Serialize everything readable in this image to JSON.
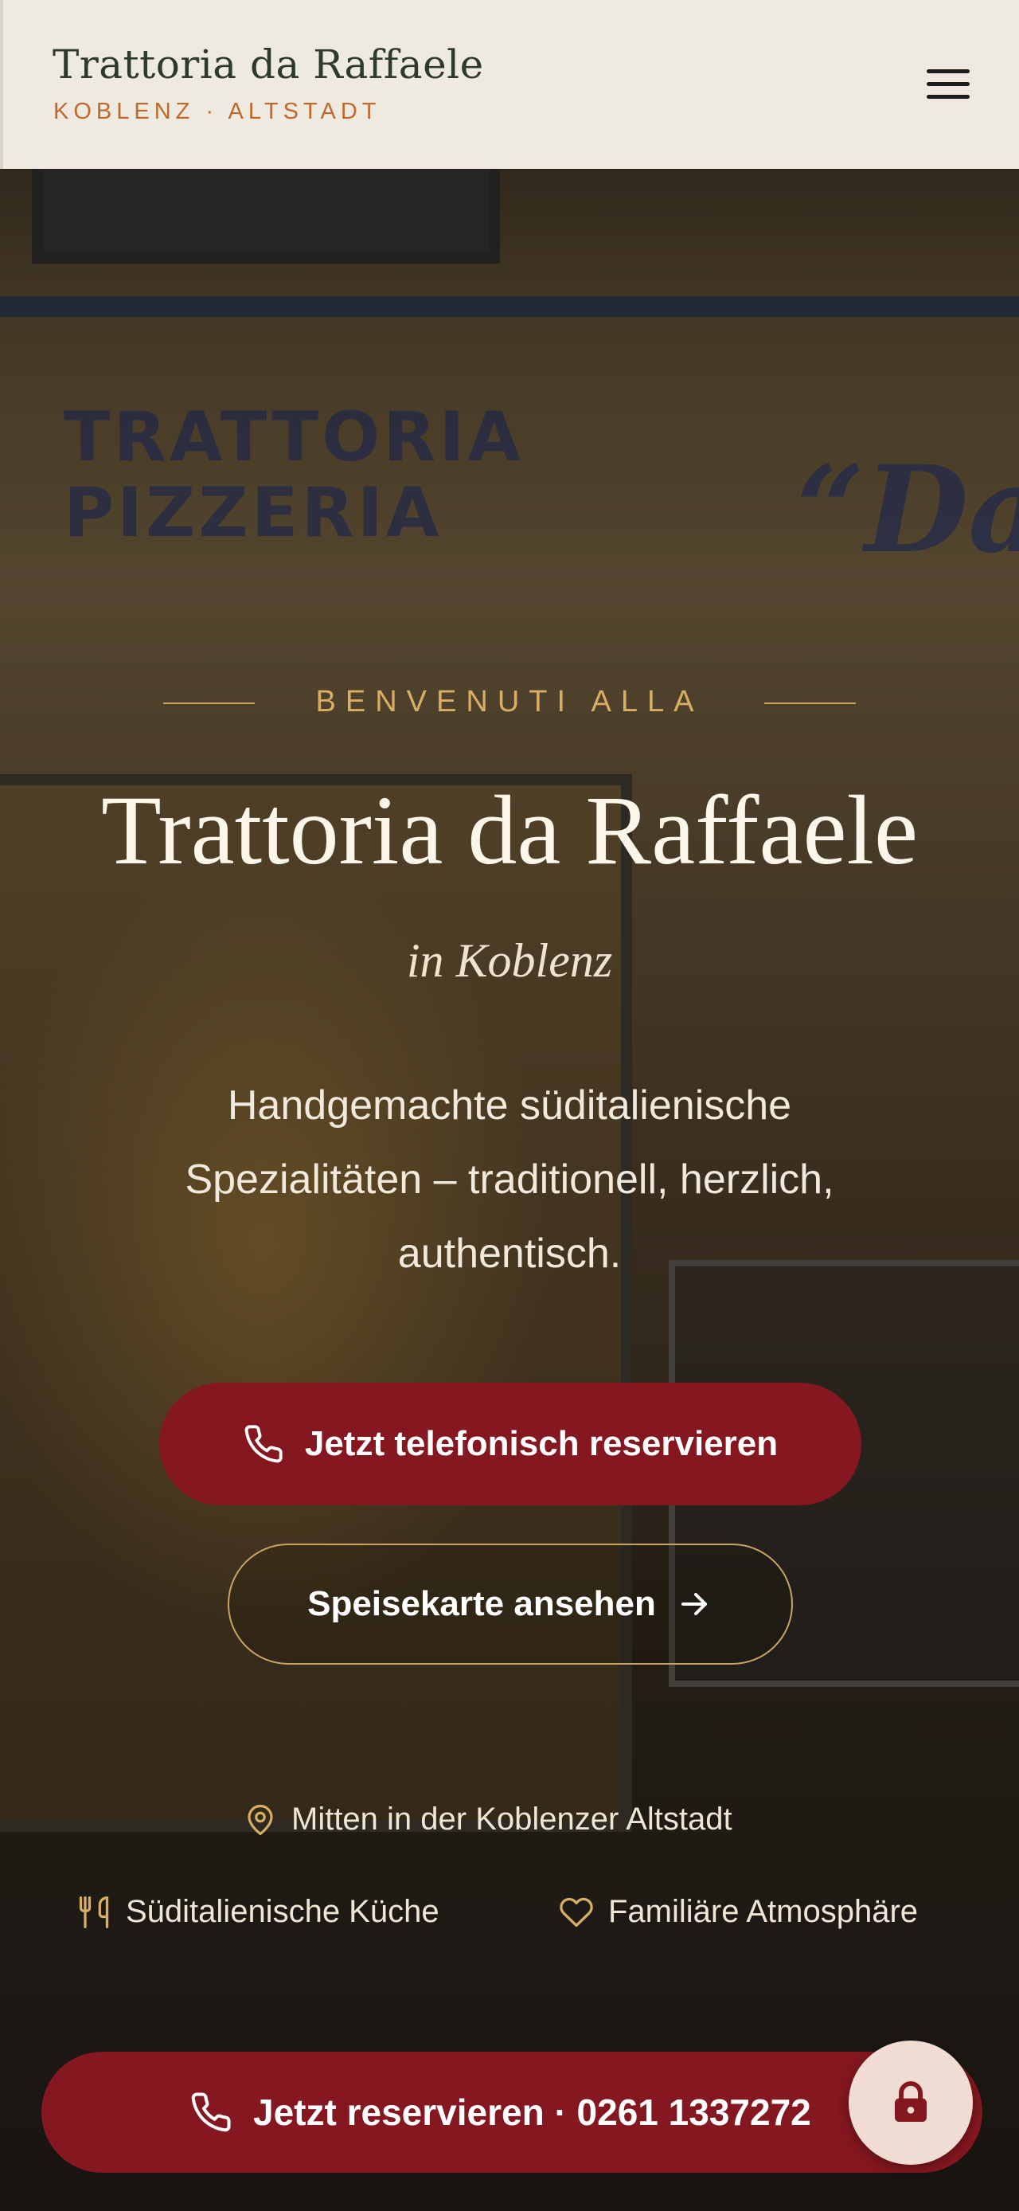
{
  "header": {
    "brand_title": "Trattoria da Raffaele",
    "brand_subtitle": "KOBLENZ · ALTSTADT",
    "menu_icon": "hamburger-menu-icon"
  },
  "hero": {
    "background_sign_line1": "TRATTORIA",
    "background_sign_line2": "PIZZERIA",
    "background_sign_da": "“Da",
    "welcome": "BENVENUTI ALLA",
    "title": "Trattoria da Raffaele",
    "subtitle": "in Koblenz",
    "tagline": "Handgemachte süditalienische Spezialitäten – traditionell, herzlich, authentisch.",
    "primary_button": {
      "label": "Jetzt telefonisch reservieren",
      "icon": "phone-icon"
    },
    "secondary_button": {
      "label": "Speisekarte ansehen",
      "icon": "arrow-right-icon"
    },
    "features": [
      {
        "label": "Mitten in der Koblenzer Altstadt",
        "icon": "map-pin-icon"
      },
      {
        "label": "Süditalienische Küche",
        "icon": "utensils-icon"
      },
      {
        "label": "Familiäre Atmosphäre",
        "icon": "heart-icon"
      }
    ]
  },
  "bottom_bar": {
    "label": "Jetzt reservieren · 0261 1337272",
    "icon": "phone-icon"
  },
  "lock_button": {
    "icon": "lock-icon"
  },
  "colors": {
    "accent_red": "#84171f",
    "gold": "#c8a561",
    "header_bg": "#efeadf",
    "brand_orange": "#c0692f"
  }
}
